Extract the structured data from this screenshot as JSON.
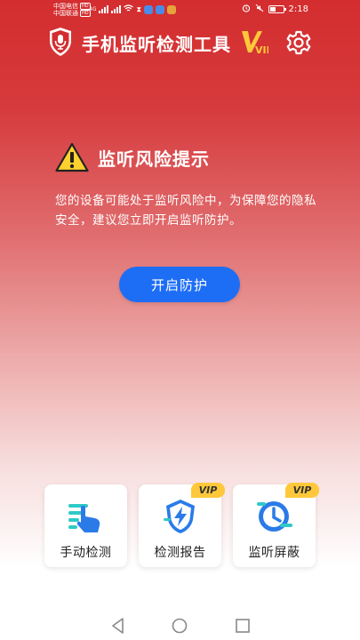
{
  "status_bar": {
    "carrier1": "中国电信",
    "carrier2": "中国联通",
    "hd": "HD",
    "net": "4G",
    "time": "2:18"
  },
  "header": {
    "title": "手机监听检测工具",
    "vip_logo_text": "VIP"
  },
  "warning": {
    "title": "监听风险提示",
    "description": "您的设备可能处于监听风险中，为保障您的隐私安全，建议您立即开启监听防护。"
  },
  "protect_button": "开启防护",
  "cards": [
    {
      "label": "手动检测",
      "vip": false
    },
    {
      "label": "检测报告",
      "vip": true,
      "vip_text": "VIP"
    },
    {
      "label": "监听屏蔽",
      "vip": true,
      "vip_text": "VIP"
    }
  ],
  "colors": {
    "primary_red": "#d42d2f",
    "button_blue": "#1e6ef5",
    "vip_gold": "#ffc83a",
    "icon_blue": "#2a7be8"
  }
}
